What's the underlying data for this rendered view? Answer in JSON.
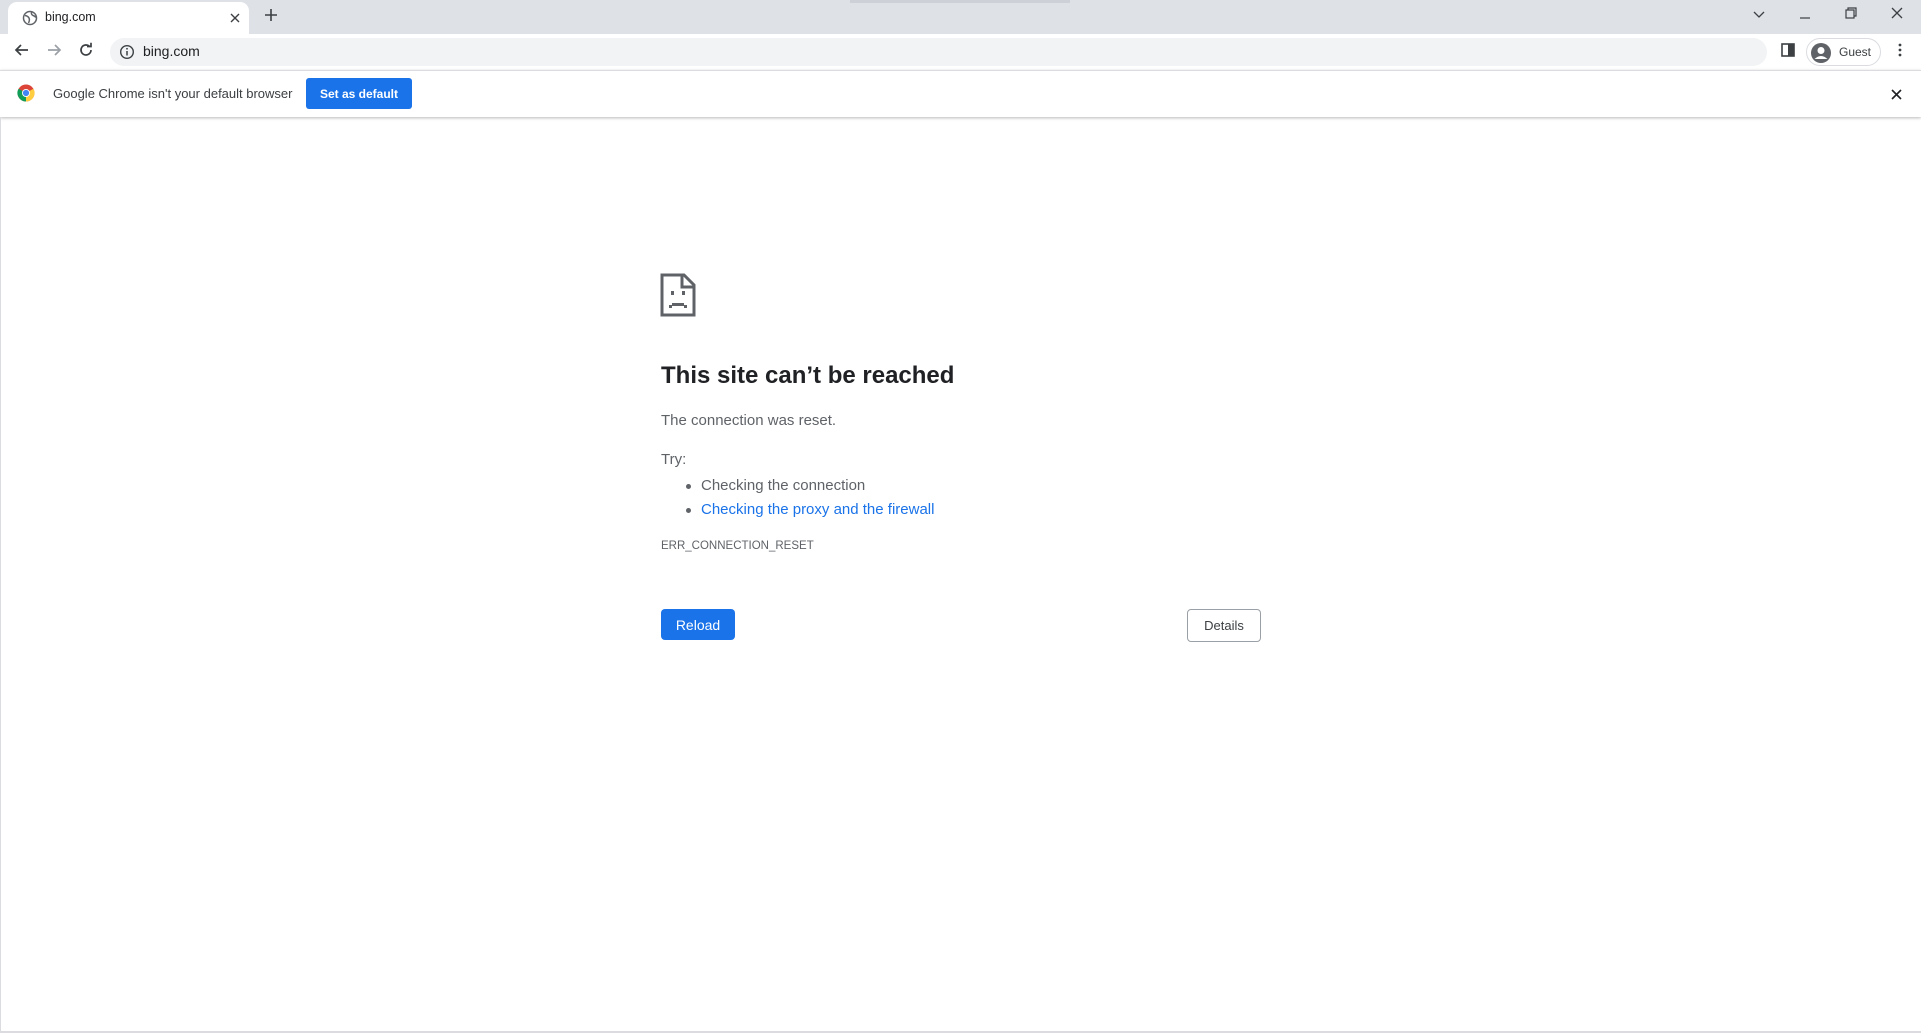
{
  "browser": {
    "tab": {
      "title": "bing.com",
      "favicon": "globe-icon"
    },
    "new_tab_icon": "plus-icon",
    "window_controls": [
      "tab-search-icon",
      "minimize-icon",
      "restore-icon",
      "close-icon"
    ],
    "address_bar": {
      "value": "bing.com",
      "info_icon": "info-icon"
    },
    "profile": {
      "label": "Guest",
      "icon": "avatar-icon"
    }
  },
  "infobar": {
    "message": "Google Chrome isn't your default browser",
    "button_label": "Set as default",
    "icon": "chrome-logo-icon"
  },
  "error_page": {
    "icon": "sad-page-icon",
    "title": "This site can’t be reached",
    "description": "The connection was reset.",
    "try_label": "Try:",
    "suggestions": [
      {
        "text": "Checking the connection",
        "is_link": false
      },
      {
        "text": "Checking the proxy and the firewall",
        "is_link": true
      }
    ],
    "error_code": "ERR_CONNECTION_RESET",
    "reload_label": "Reload",
    "details_label": "Details"
  },
  "colors": {
    "accent": "#1a73e8",
    "tabstrip_bg": "#dee1e6",
    "omnibox_bg": "#f1f3f4",
    "text_secondary": "#5f6368"
  }
}
